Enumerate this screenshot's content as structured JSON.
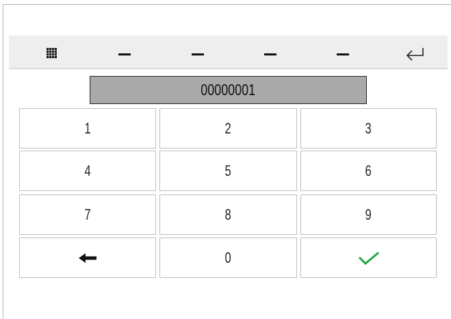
{
  "toolbar": {
    "left_icon": "grid-icon",
    "right_icon": "enter-icon",
    "slots": [
      "—",
      "—",
      "—",
      "—"
    ]
  },
  "display": {
    "value": "00000001"
  },
  "keypad": {
    "keys": [
      "1",
      "2",
      "3",
      "4",
      "5",
      "6",
      "7",
      "8",
      "9",
      "0"
    ],
    "backspace_icon": "arrow-left-icon",
    "confirm_icon": "checkmark-icon",
    "confirm_color": "#1ea83a"
  }
}
